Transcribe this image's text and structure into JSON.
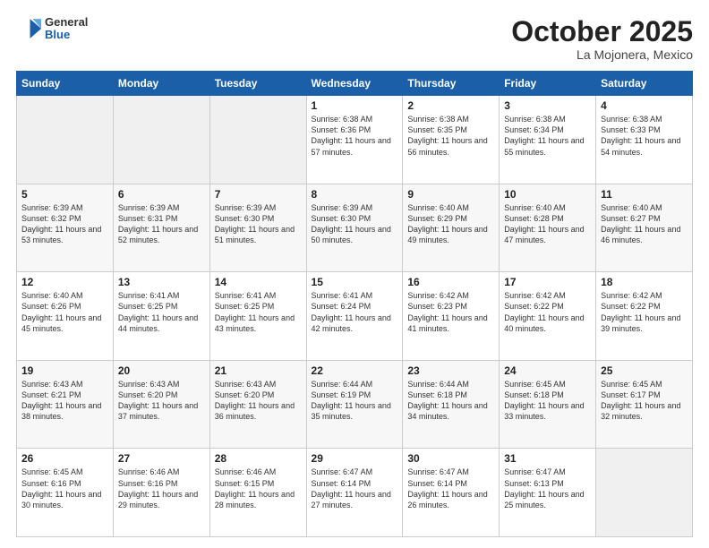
{
  "header": {
    "logo_general": "General",
    "logo_blue": "Blue",
    "month": "October 2025",
    "location": "La Mojonera, Mexico"
  },
  "days_of_week": [
    "Sunday",
    "Monday",
    "Tuesday",
    "Wednesday",
    "Thursday",
    "Friday",
    "Saturday"
  ],
  "weeks": [
    [
      {
        "day": "",
        "info": ""
      },
      {
        "day": "",
        "info": ""
      },
      {
        "day": "",
        "info": ""
      },
      {
        "day": "1",
        "info": "Sunrise: 6:38 AM\nSunset: 6:36 PM\nDaylight: 11 hours and 57 minutes."
      },
      {
        "day": "2",
        "info": "Sunrise: 6:38 AM\nSunset: 6:35 PM\nDaylight: 11 hours and 56 minutes."
      },
      {
        "day": "3",
        "info": "Sunrise: 6:38 AM\nSunset: 6:34 PM\nDaylight: 11 hours and 55 minutes."
      },
      {
        "day": "4",
        "info": "Sunrise: 6:38 AM\nSunset: 6:33 PM\nDaylight: 11 hours and 54 minutes."
      }
    ],
    [
      {
        "day": "5",
        "info": "Sunrise: 6:39 AM\nSunset: 6:32 PM\nDaylight: 11 hours and 53 minutes."
      },
      {
        "day": "6",
        "info": "Sunrise: 6:39 AM\nSunset: 6:31 PM\nDaylight: 11 hours and 52 minutes."
      },
      {
        "day": "7",
        "info": "Sunrise: 6:39 AM\nSunset: 6:30 PM\nDaylight: 11 hours and 51 minutes."
      },
      {
        "day": "8",
        "info": "Sunrise: 6:39 AM\nSunset: 6:30 PM\nDaylight: 11 hours and 50 minutes."
      },
      {
        "day": "9",
        "info": "Sunrise: 6:40 AM\nSunset: 6:29 PM\nDaylight: 11 hours and 49 minutes."
      },
      {
        "day": "10",
        "info": "Sunrise: 6:40 AM\nSunset: 6:28 PM\nDaylight: 11 hours and 47 minutes."
      },
      {
        "day": "11",
        "info": "Sunrise: 6:40 AM\nSunset: 6:27 PM\nDaylight: 11 hours and 46 minutes."
      }
    ],
    [
      {
        "day": "12",
        "info": "Sunrise: 6:40 AM\nSunset: 6:26 PM\nDaylight: 11 hours and 45 minutes."
      },
      {
        "day": "13",
        "info": "Sunrise: 6:41 AM\nSunset: 6:25 PM\nDaylight: 11 hours and 44 minutes."
      },
      {
        "day": "14",
        "info": "Sunrise: 6:41 AM\nSunset: 6:25 PM\nDaylight: 11 hours and 43 minutes."
      },
      {
        "day": "15",
        "info": "Sunrise: 6:41 AM\nSunset: 6:24 PM\nDaylight: 11 hours and 42 minutes."
      },
      {
        "day": "16",
        "info": "Sunrise: 6:42 AM\nSunset: 6:23 PM\nDaylight: 11 hours and 41 minutes."
      },
      {
        "day": "17",
        "info": "Sunrise: 6:42 AM\nSunset: 6:22 PM\nDaylight: 11 hours and 40 minutes."
      },
      {
        "day": "18",
        "info": "Sunrise: 6:42 AM\nSunset: 6:22 PM\nDaylight: 11 hours and 39 minutes."
      }
    ],
    [
      {
        "day": "19",
        "info": "Sunrise: 6:43 AM\nSunset: 6:21 PM\nDaylight: 11 hours and 38 minutes."
      },
      {
        "day": "20",
        "info": "Sunrise: 6:43 AM\nSunset: 6:20 PM\nDaylight: 11 hours and 37 minutes."
      },
      {
        "day": "21",
        "info": "Sunrise: 6:43 AM\nSunset: 6:20 PM\nDaylight: 11 hours and 36 minutes."
      },
      {
        "day": "22",
        "info": "Sunrise: 6:44 AM\nSunset: 6:19 PM\nDaylight: 11 hours and 35 minutes."
      },
      {
        "day": "23",
        "info": "Sunrise: 6:44 AM\nSunset: 6:18 PM\nDaylight: 11 hours and 34 minutes."
      },
      {
        "day": "24",
        "info": "Sunrise: 6:45 AM\nSunset: 6:18 PM\nDaylight: 11 hours and 33 minutes."
      },
      {
        "day": "25",
        "info": "Sunrise: 6:45 AM\nSunset: 6:17 PM\nDaylight: 11 hours and 32 minutes."
      }
    ],
    [
      {
        "day": "26",
        "info": "Sunrise: 6:45 AM\nSunset: 6:16 PM\nDaylight: 11 hours and 30 minutes."
      },
      {
        "day": "27",
        "info": "Sunrise: 6:46 AM\nSunset: 6:16 PM\nDaylight: 11 hours and 29 minutes."
      },
      {
        "day": "28",
        "info": "Sunrise: 6:46 AM\nSunset: 6:15 PM\nDaylight: 11 hours and 28 minutes."
      },
      {
        "day": "29",
        "info": "Sunrise: 6:47 AM\nSunset: 6:14 PM\nDaylight: 11 hours and 27 minutes."
      },
      {
        "day": "30",
        "info": "Sunrise: 6:47 AM\nSunset: 6:14 PM\nDaylight: 11 hours and 26 minutes."
      },
      {
        "day": "31",
        "info": "Sunrise: 6:47 AM\nSunset: 6:13 PM\nDaylight: 11 hours and 25 minutes."
      },
      {
        "day": "",
        "info": ""
      }
    ]
  ]
}
